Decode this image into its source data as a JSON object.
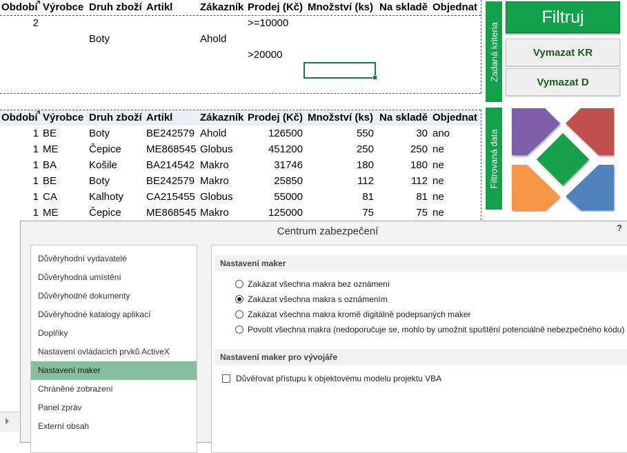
{
  "headers": [
    "Období",
    "Výrobce",
    "Druh zboží",
    "Artikl",
    "Zákazník",
    "Prodej (Kč)",
    "Množství (ks)",
    "Na skladě",
    "Objednat"
  ],
  "criteria": {
    "row1": {
      "obdobi": "2",
      "prodej": ">=10000"
    },
    "row2": {
      "druh": "Boty",
      "zakaznik": "Ahold"
    },
    "row3": {
      "prodej": ">20000"
    }
  },
  "data_rows": [
    {
      "obdobi": "1",
      "vyrobce": "BE",
      "druh": "Boty",
      "artikl": "BE242579",
      "zakaznik": "Ahold",
      "prodej": "126500",
      "mnozstvi": "550",
      "sklad": "30",
      "objednat": "ano"
    },
    {
      "obdobi": "1",
      "vyrobce": "ME",
      "druh": "Čepice",
      "artikl": "ME868545",
      "zakaznik": "Globus",
      "prodej": "451200",
      "mnozstvi": "250",
      "sklad": "250",
      "objednat": "ne"
    },
    {
      "obdobi": "1",
      "vyrobce": "BA",
      "druh": "Košile",
      "artikl": "BA214542",
      "zakaznik": "Makro",
      "prodej": "31746",
      "mnozstvi": "180",
      "sklad": "180",
      "objednat": "ne"
    },
    {
      "obdobi": "1",
      "vyrobce": "BE",
      "druh": "Boty",
      "artikl": "BE242579",
      "zakaznik": "Makro",
      "prodej": "25850",
      "mnozstvi": "112",
      "sklad": "112",
      "objednat": "ne"
    },
    {
      "obdobi": "1",
      "vyrobce": "CA",
      "druh": "Kalhoty",
      "artikl": "CA215455",
      "zakaznik": "Globus",
      "prodej": "55000",
      "mnozstvi": "81",
      "sklad": "81",
      "objednat": "ne"
    },
    {
      "obdobi": "1",
      "vyrobce": "ME",
      "druh": "Čepice",
      "artikl": "ME868545",
      "zakaznik": "Makro",
      "prodej": "125000",
      "mnozstvi": "75",
      "sklad": "75",
      "objednat": "ne"
    }
  ],
  "side_labels": {
    "criteria": "Zadaná kriteria",
    "filtered": "Filtrovaná data"
  },
  "buttons": {
    "filter": "Filtruj",
    "clear_kr": "Vymazat KR",
    "clear_d": "Vymazat D"
  },
  "logo_colors": {
    "purple": "#7b5ea7",
    "red": "#c0504d",
    "green": "#13a04b",
    "orange": "#f79646",
    "blue": "#4f81bd"
  },
  "dialog": {
    "title": "Centrum zabezpečení",
    "help": "?",
    "nav": [
      "Důvěryhodní vydavatelé",
      "Důvěryhodná umístění",
      "Důvěryhodné dokumenty",
      "Důvěryhodné katalogy aplikací",
      "Doplňky",
      "Nastavení ovládacích prvků ActiveX",
      "Nastavení maker",
      "Chráněné zobrazení",
      "Panel zpráv",
      "Externí obsah"
    ],
    "section1": "Nastavení maker",
    "options": [
      "Zakázat všechna makra bez oznámení",
      "Zakázat všechna makra s oznámením",
      "Zakázat všechna makra kromě digitálně podepsaných maker",
      "Povolit všechna makra (nedoporučuje se, mohlo by umožnit spuštění potenciálně nebezpečného kódu)"
    ],
    "selected_option": 1,
    "section2": "Nastavení maker pro vývojáře",
    "checkbox_label": "Důvěřovat přístupu k objektovému modelu projektu VBA",
    "checkbox_checked": false
  }
}
